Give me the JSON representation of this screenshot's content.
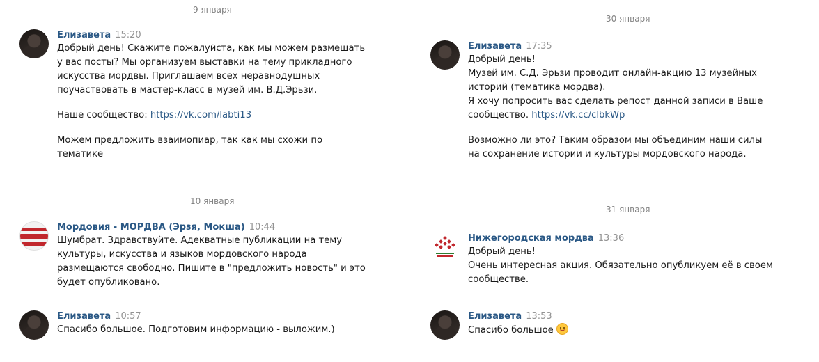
{
  "left": {
    "date1": "9 января",
    "m1": {
      "author": "Елизавета",
      "time": "15:20",
      "lines": [
        "Добрый день! Скажите пожалуйста, как мы можем размещать",
        "у вас посты? Мы организуем выставки на тему прикладного",
        "искусства мордвы. Приглашаем всех неравнодушных",
        "поучаствовать в мастер-класс в музей им. В.Д.Эрьзи."
      ],
      "community_prefix": "Наше сообщество: ",
      "community_link": "https://vk.com/labti13",
      "closing": [
        "Можем предложить взаимопиар, так как мы схожи по",
        "тематике"
      ]
    },
    "date2": "10 января",
    "m2": {
      "author": "Мордовия - МОРДВА (Эрзя, Мокша)",
      "time": "10:44",
      "lines": [
        "Шумбрат. Здравствуйте. Адекватные публикации на тему",
        "культуры, искусства и языков мордовского народа",
        "размещаются свободно. Пишите в \"предложить новость\" и это",
        "будет опубликовано."
      ]
    },
    "m3": {
      "author": "Елизавета",
      "time": "10:57",
      "text": "Спасибо большое. Подготовим информацию - выложим.)"
    }
  },
  "right": {
    "date1": "30 января",
    "m1": {
      "author": "Елизавета",
      "time": "17:35",
      "lines": [
        "Добрый день!",
        "Музей им. С.Д. Эрьзи проводит онлайн-акцию 13 музейных",
        "историй (тематика мордва).",
        "Я хочу попросить вас сделать репост данной записи в Ваше"
      ],
      "link_prefix": "сообщество. ",
      "link": "https://vk.cc/clbkWp",
      "closing": [
        "Возможно ли это? Таким образом мы объединим наши силы",
        "на сохранение истории и культуры мордовского народа."
      ]
    },
    "date2": "31 января",
    "m2": {
      "author": "Нижегородская мордва",
      "time": "13:36",
      "lines": [
        "Добрый день!",
        "Очень интересная акция. Обязательно опубликуем её в своем",
        "сообществе."
      ]
    },
    "m3": {
      "author": "Елизавета",
      "time": "13:53",
      "text": "Спасибо большое"
    }
  },
  "colors": {
    "author": "#2a5885",
    "time": "#939393",
    "date": "#828282",
    "link": "#2a5885"
  }
}
